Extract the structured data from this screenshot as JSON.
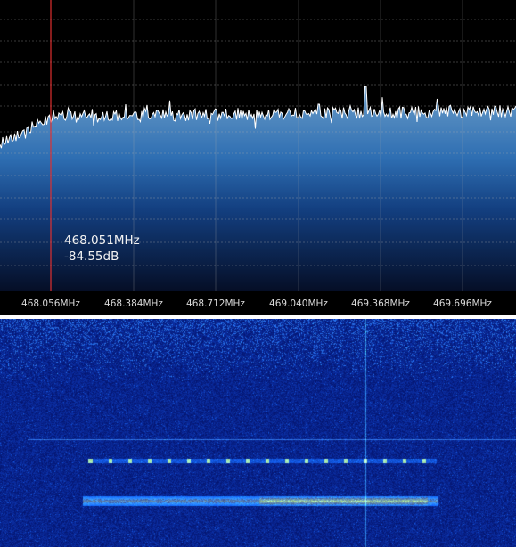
{
  "spectrum": {
    "cursor": {
      "frequency_label": "468.051MHz",
      "level_label": "-84.55dB"
    },
    "freq_axis": {
      "ticks": [
        "468.056MHz",
        "468.384MHz",
        "468.712MHz",
        "469.040MHz",
        "469.368MHz",
        "469.696MHz"
      ]
    },
    "colors": {
      "background": "#000000",
      "trace": "#ffffff",
      "fill_top": "#5b8fbf",
      "fill_mid": "#1e5a9a",
      "fill_bottom": "#06122e",
      "cursor_line": "#e03030",
      "grid": "#555555"
    }
  },
  "waterfall": {
    "colors": {
      "background": "#0a1f8a",
      "signal_low": "#2f66e8",
      "signal_high": "#e8f040"
    }
  }
}
